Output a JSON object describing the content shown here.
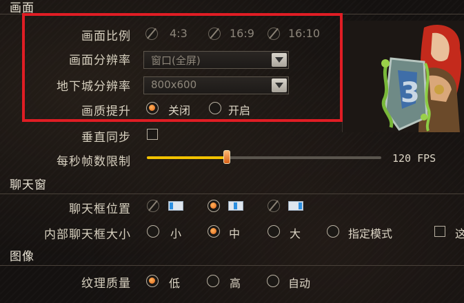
{
  "sections": {
    "display": "画面",
    "chat": "聊天窗",
    "image": "图像"
  },
  "display": {
    "ratio": {
      "label": "画面比例",
      "options": [
        "4:3",
        "16:9",
        "16:10"
      ]
    },
    "resolution": {
      "label": "画面分辨率",
      "value": "窗口(全屏)"
    },
    "dungeon_resolution": {
      "label": "地下城分辨率",
      "value": "800x600"
    },
    "quality_boost": {
      "label": "画质提升",
      "options": [
        "关闭",
        "开启"
      ],
      "selected": "关闭"
    },
    "vsync": {
      "label": "垂直同步",
      "checked": false
    },
    "fps_limit": {
      "label": "每秒帧数限制",
      "value_text": "120 FPS",
      "fill_fraction": 0.34
    }
  },
  "chat": {
    "position": {
      "label": "聊天框位置",
      "selected_index": 1
    },
    "size": {
      "label": "内部聊天框大小",
      "options": [
        "小",
        "中",
        "大",
        "指定模式"
      ],
      "selected": "中",
      "extra_checkbox_text": "这"
    }
  },
  "image": {
    "texture": {
      "label": "纹理质量",
      "options": [
        "低",
        "高",
        "自动"
      ],
      "selected": "低"
    }
  },
  "colors": {
    "accent": "#e0651a",
    "highlight_border": "#e01d24",
    "slider_fill": "#f2c200",
    "text": "#d7d0bf"
  },
  "icons": [
    "radio-disabled-icon",
    "dropdown-arrow-icon",
    "chat-position-icon",
    "character-art-image"
  ]
}
